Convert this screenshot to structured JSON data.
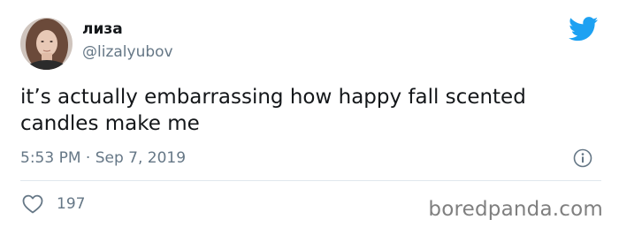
{
  "user": {
    "display_name": "лиза",
    "handle": "@lizalyubov",
    "avatar": "profile-photo"
  },
  "tweet": {
    "text": "it’s actually embarrassing how happy fall scented candles make me",
    "time": "5:53 PM",
    "separator": "·",
    "date": "Sep 7, 2019"
  },
  "engagement": {
    "likes": "197"
  },
  "icons": {
    "brand": "twitter-bird-icon",
    "info": "info-icon",
    "like": "heart-outline-icon"
  },
  "watermark": {
    "text": "boredpanda.com"
  },
  "colors": {
    "twitter_blue": "#1da1f2",
    "text_primary": "#14171a",
    "text_secondary": "#657786",
    "divider": "#e1e8ed",
    "watermark": "#7f7f7f"
  }
}
